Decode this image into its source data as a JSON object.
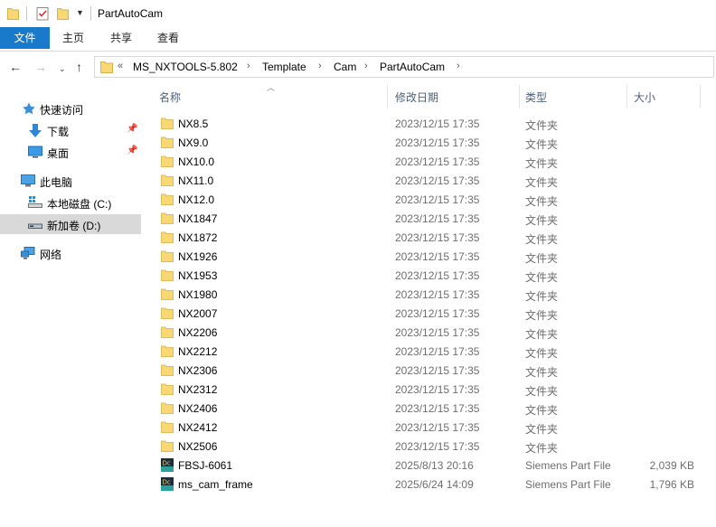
{
  "window": {
    "title": "PartAutoCam"
  },
  "ribbon": {
    "tabs": [
      "文件",
      "主页",
      "共享",
      "查看"
    ]
  },
  "address": {
    "overflow": "«",
    "crumbs": [
      "MS_NXTOOLS-5.802",
      "Template",
      "Cam",
      "PartAutoCam"
    ]
  },
  "navigation": {
    "quick_access": "快速访问",
    "downloads": "下载",
    "desktop": "桌面",
    "this_pc": "此电脑",
    "local_disk": "本地磁盘 (C:)",
    "new_volume": "新加卷 (D:)",
    "network": "网络"
  },
  "columns": {
    "name": "名称",
    "date": "修改日期",
    "type": "类型",
    "size": "大小"
  },
  "files": [
    {
      "name": "NX8.5",
      "date": "2023/12/15 17:35",
      "type": "文件夹",
      "size": "",
      "icon": "folder-icon"
    },
    {
      "name": "NX9.0",
      "date": "2023/12/15 17:35",
      "type": "文件夹",
      "size": "",
      "icon": "folder-icon"
    },
    {
      "name": "NX10.0",
      "date": "2023/12/15 17:35",
      "type": "文件夹",
      "size": "",
      "icon": "folder-icon"
    },
    {
      "name": "NX11.0",
      "date": "2023/12/15 17:35",
      "type": "文件夹",
      "size": "",
      "icon": "folder-icon"
    },
    {
      "name": "NX12.0",
      "date": "2023/12/15 17:35",
      "type": "文件夹",
      "size": "",
      "icon": "folder-icon"
    },
    {
      "name": "NX1847",
      "date": "2023/12/15 17:35",
      "type": "文件夹",
      "size": "",
      "icon": "folder-icon"
    },
    {
      "name": "NX1872",
      "date": "2023/12/15 17:35",
      "type": "文件夹",
      "size": "",
      "icon": "folder-icon"
    },
    {
      "name": "NX1926",
      "date": "2023/12/15 17:35",
      "type": "文件夹",
      "size": "",
      "icon": "folder-icon"
    },
    {
      "name": "NX1953",
      "date": "2023/12/15 17:35",
      "type": "文件夹",
      "size": "",
      "icon": "folder-icon"
    },
    {
      "name": "NX1980",
      "date": "2023/12/15 17:35",
      "type": "文件夹",
      "size": "",
      "icon": "folder-icon"
    },
    {
      "name": "NX2007",
      "date": "2023/12/15 17:35",
      "type": "文件夹",
      "size": "",
      "icon": "folder-icon"
    },
    {
      "name": "NX2206",
      "date": "2023/12/15 17:35",
      "type": "文件夹",
      "size": "",
      "icon": "folder-icon"
    },
    {
      "name": "NX2212",
      "date": "2023/12/15 17:35",
      "type": "文件夹",
      "size": "",
      "icon": "folder-icon"
    },
    {
      "name": "NX2306",
      "date": "2023/12/15 17:35",
      "type": "文件夹",
      "size": "",
      "icon": "folder-icon"
    },
    {
      "name": "NX2312",
      "date": "2023/12/15 17:35",
      "type": "文件夹",
      "size": "",
      "icon": "folder-icon"
    },
    {
      "name": "NX2406",
      "date": "2023/12/15 17:35",
      "type": "文件夹",
      "size": "",
      "icon": "folder-icon"
    },
    {
      "name": "NX2412",
      "date": "2023/12/15 17:35",
      "type": "文件夹",
      "size": "",
      "icon": "folder-icon"
    },
    {
      "name": "NX2506",
      "date": "2023/12/15 17:35",
      "type": "文件夹",
      "size": "",
      "icon": "folder-icon"
    },
    {
      "name": "FBSJ-6061",
      "date": "2025/8/13 20:16",
      "type": "Siemens Part File",
      "size": "2,039 KB",
      "icon": "nx-part-file-icon"
    },
    {
      "name": "ms_cam_frame",
      "date": "2025/6/24 14:09",
      "type": "Siemens Part File",
      "size": "1,796 KB",
      "icon": "nx-part-file-icon"
    }
  ],
  "icon_labels": {
    "part_file": "Dc"
  },
  "colors": {
    "accent": "#1979ca",
    "folder": "#f8d775",
    "selected": "#d9d9d9",
    "header_text": "#4c607a",
    "secondary_text": "#6d6d6d",
    "part_icon": "#2aa19a"
  }
}
